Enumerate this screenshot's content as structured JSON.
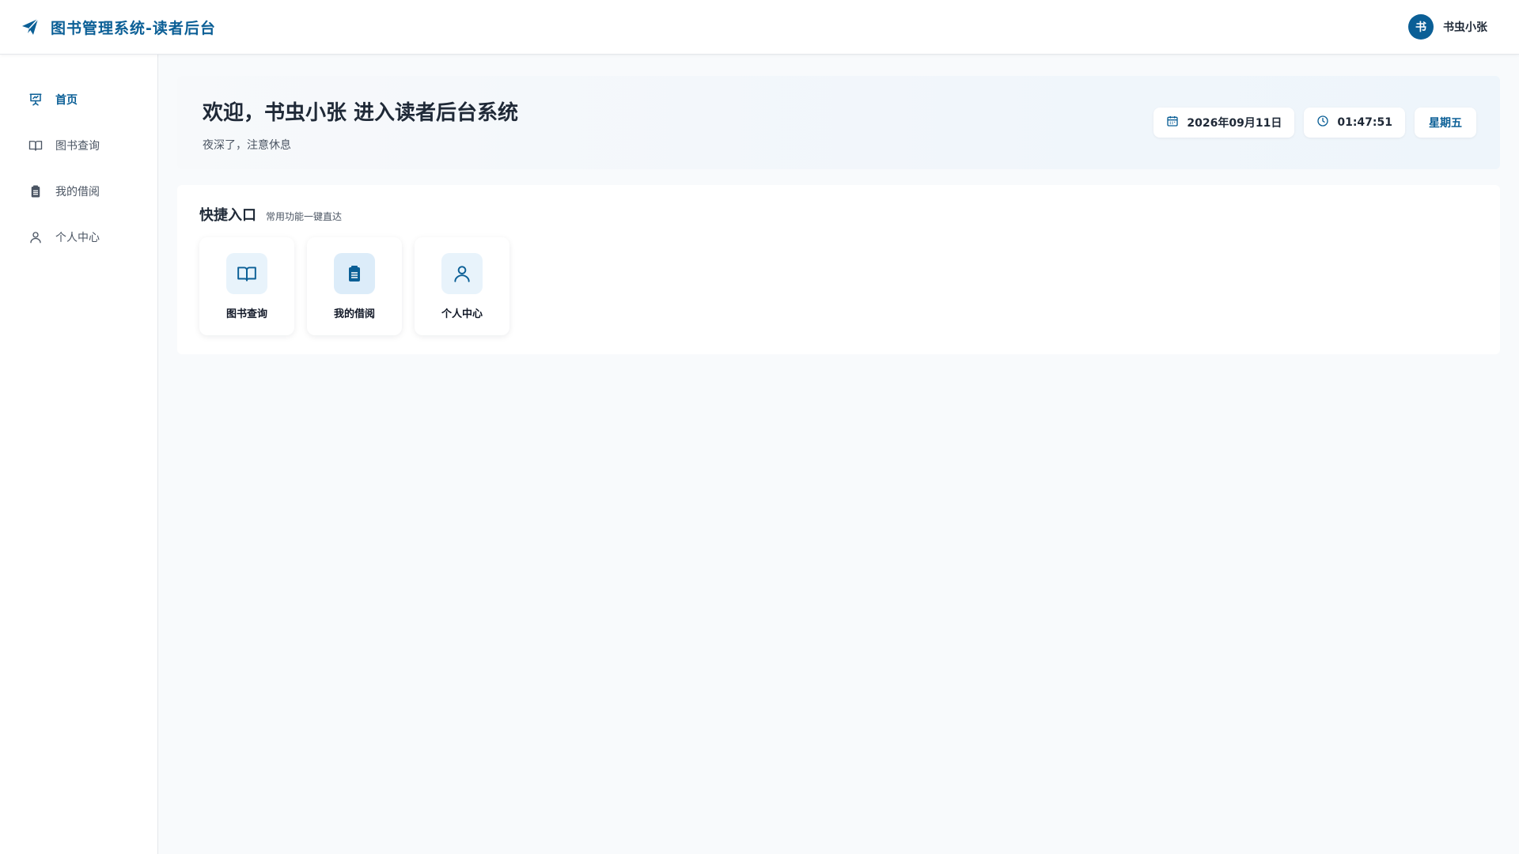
{
  "app": {
    "title": "图书管理系统-读者后台"
  },
  "user": {
    "avatar_text": "书",
    "name": "书虫小张"
  },
  "sidebar": {
    "items": [
      {
        "label": "首页",
        "icon": "presentation-icon",
        "active": true
      },
      {
        "label": "图书查询",
        "icon": "book-open-icon",
        "active": false
      },
      {
        "label": "我的借阅",
        "icon": "clipboard-icon",
        "active": false
      },
      {
        "label": "个人中心",
        "icon": "user-icon",
        "active": false
      }
    ]
  },
  "welcome": {
    "title": "欢迎，书虫小张 进入读者后台系统",
    "subtitle": "夜深了，注意休息",
    "date": "2026年09月11日",
    "time": "01:47:51",
    "weekday": "星期五"
  },
  "quick": {
    "title": "快捷入口",
    "subtitle": "常用功能一键直达",
    "cards": [
      {
        "label": "图书查询",
        "icon": "book-open-icon"
      },
      {
        "label": "我的借阅",
        "icon": "clipboard-icon"
      },
      {
        "label": "个人中心",
        "icon": "user-icon"
      }
    ]
  },
  "colors": {
    "primary": "#0b5f96",
    "background": "#f8fafc",
    "text": "#1f2937"
  }
}
